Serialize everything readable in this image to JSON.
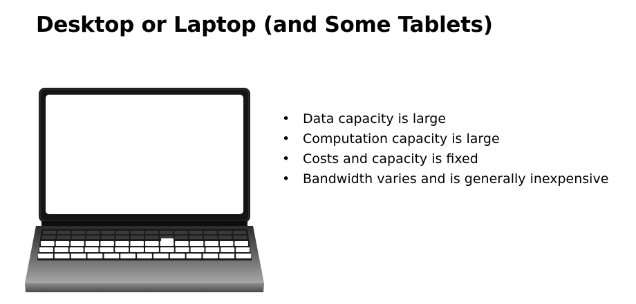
{
  "slide": {
    "title": "Desktop or Laptop (and Some Tablets)"
  },
  "bullets": [
    "Data capacity is large",
    "Computation capacity is large",
    "Costs and capacity is fixed",
    "Bandwidth varies and is generally inexpensive"
  ],
  "bullet_symbol": "•",
  "image": {
    "icon": "laptop-icon"
  },
  "colors": {
    "text": "#000000",
    "background": "#ffffff",
    "laptop_body": "#1a1a1a",
    "screen": "#ffffff",
    "base_light": "#9a9a9a",
    "base_dark": "#3a3a3a"
  }
}
